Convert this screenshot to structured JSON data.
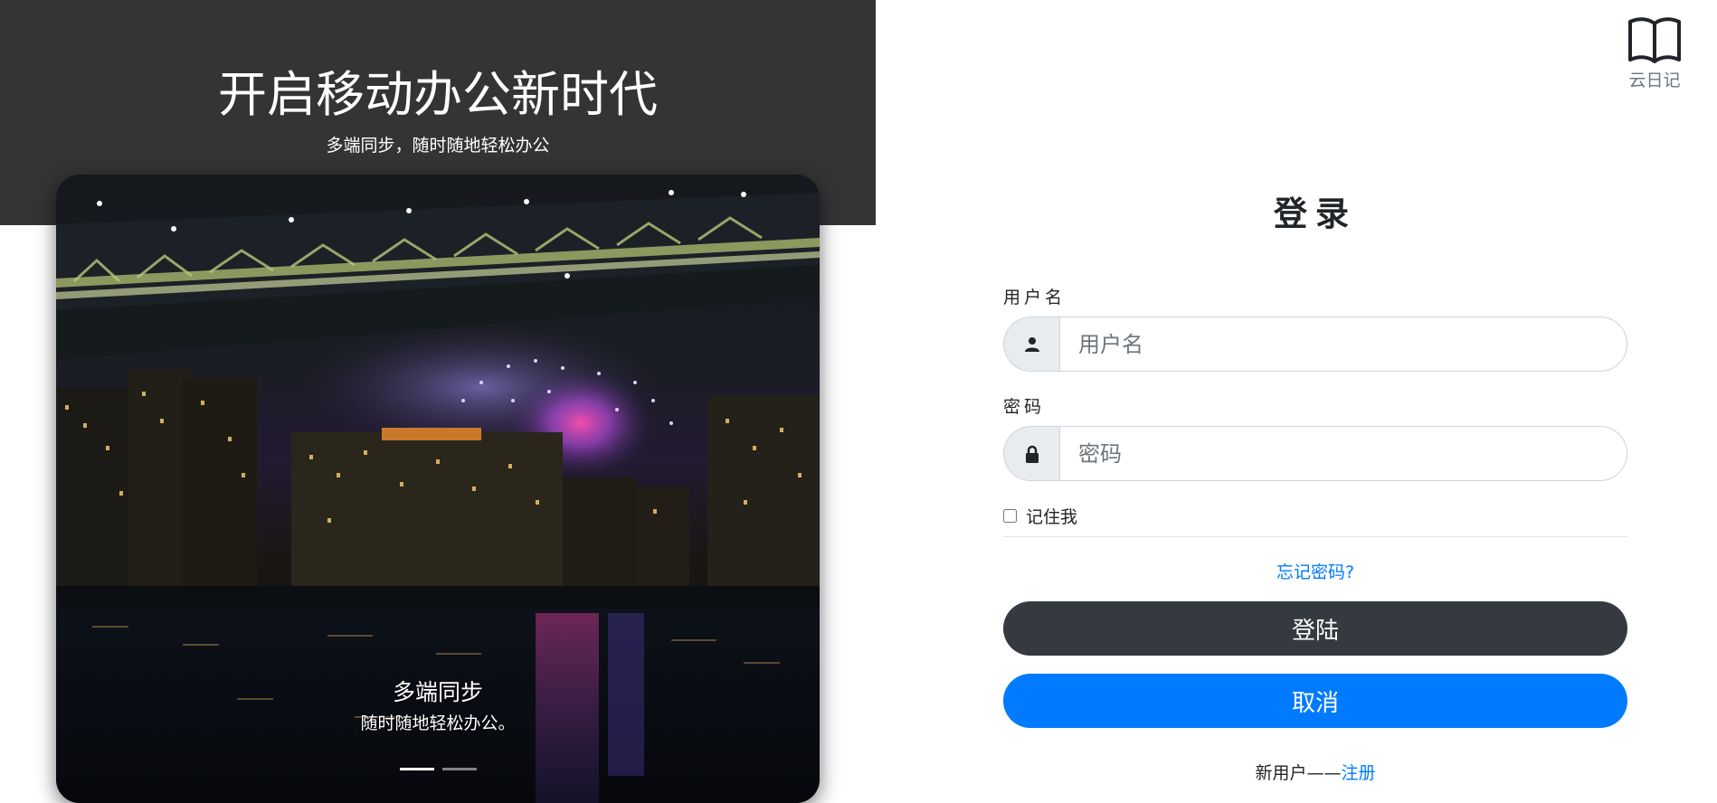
{
  "hero": {
    "title": "开启移动办公新时代",
    "subtitle": "多端同步，随时随地轻松办公"
  },
  "carousel": {
    "image": "night-city-fireworks-bridge",
    "caption_title": "多端同步",
    "caption_text": "随时随地轻松办公。",
    "slide_count": 2,
    "active_slide": 1
  },
  "brand": {
    "icon": "book-icon",
    "label": "云日记"
  },
  "login": {
    "title": "登录",
    "username_label": "用户名",
    "username_placeholder": "用户名",
    "username_icon": "person-icon",
    "password_label": "密码",
    "password_placeholder": "密码",
    "password_icon": "lock-icon",
    "remember_label": "记住我",
    "remember_checked": false,
    "forgot_link": "忘记密码?",
    "submit_label": "登陆",
    "cancel_label": "取消",
    "register_prefix": "新用户——",
    "register_link": "注册"
  },
  "colors": {
    "banner": "#343434",
    "primary": "#007bff",
    "dark": "#343a40"
  }
}
